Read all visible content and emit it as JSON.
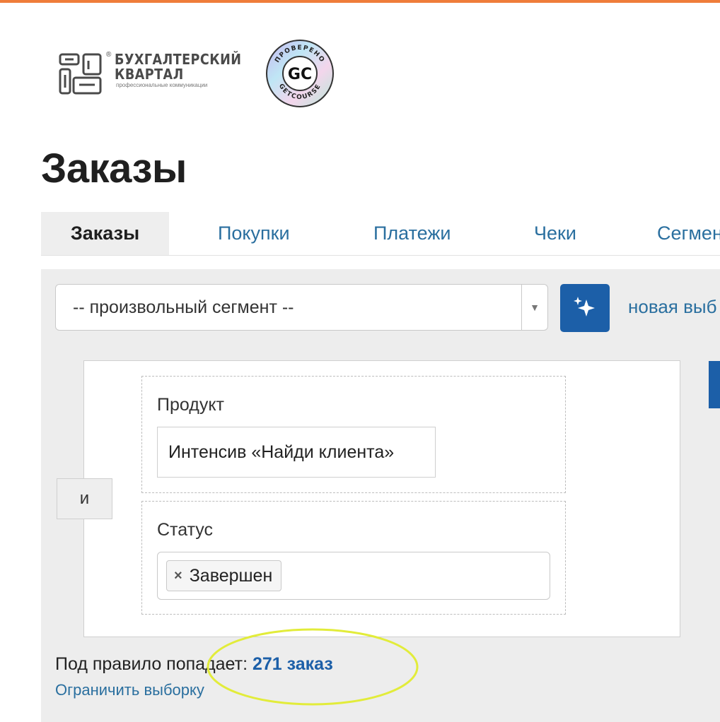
{
  "colors": {
    "accent_bar": "#ef7d3a",
    "link": "#2a6f9f",
    "primary": "#1c5fa8",
    "highlight": "#e2ec3a"
  },
  "logos": {
    "bk": {
      "line1": "БУХГАЛТЕРСКИЙ",
      "line2": "КВАРТАЛ",
      "sub": "профессиональные коммуникации",
      "mark": "®"
    },
    "gc": {
      "center": "GC",
      "ring_top": "ПРОВЕРЕНО",
      "ring_bottom": "GETCOURSE"
    }
  },
  "page_title": "Заказы",
  "tabs": [
    {
      "label": "Заказы",
      "active": true
    },
    {
      "label": "Покупки",
      "active": false
    },
    {
      "label": "Платежи",
      "active": false
    },
    {
      "label": "Чеки",
      "active": false
    },
    {
      "label": "Сегмен",
      "active": false
    }
  ],
  "segment": {
    "selected": "-- произвольный сегмент --",
    "arrow_icon": "triangle-down",
    "magic_icon": "sparkles-icon",
    "new_link": "новая выб"
  },
  "rules": {
    "operator": "и",
    "conditions": [
      {
        "label": "Продукт",
        "value": "Интенсив «Найди клиента»"
      },
      {
        "label": "Статус",
        "chip": "Завершен",
        "chip_remove": "×"
      }
    ]
  },
  "result": {
    "prefix": "Под правило попадает: ",
    "count": "271 заказ",
    "limit_link": "Ограничить выборку"
  }
}
